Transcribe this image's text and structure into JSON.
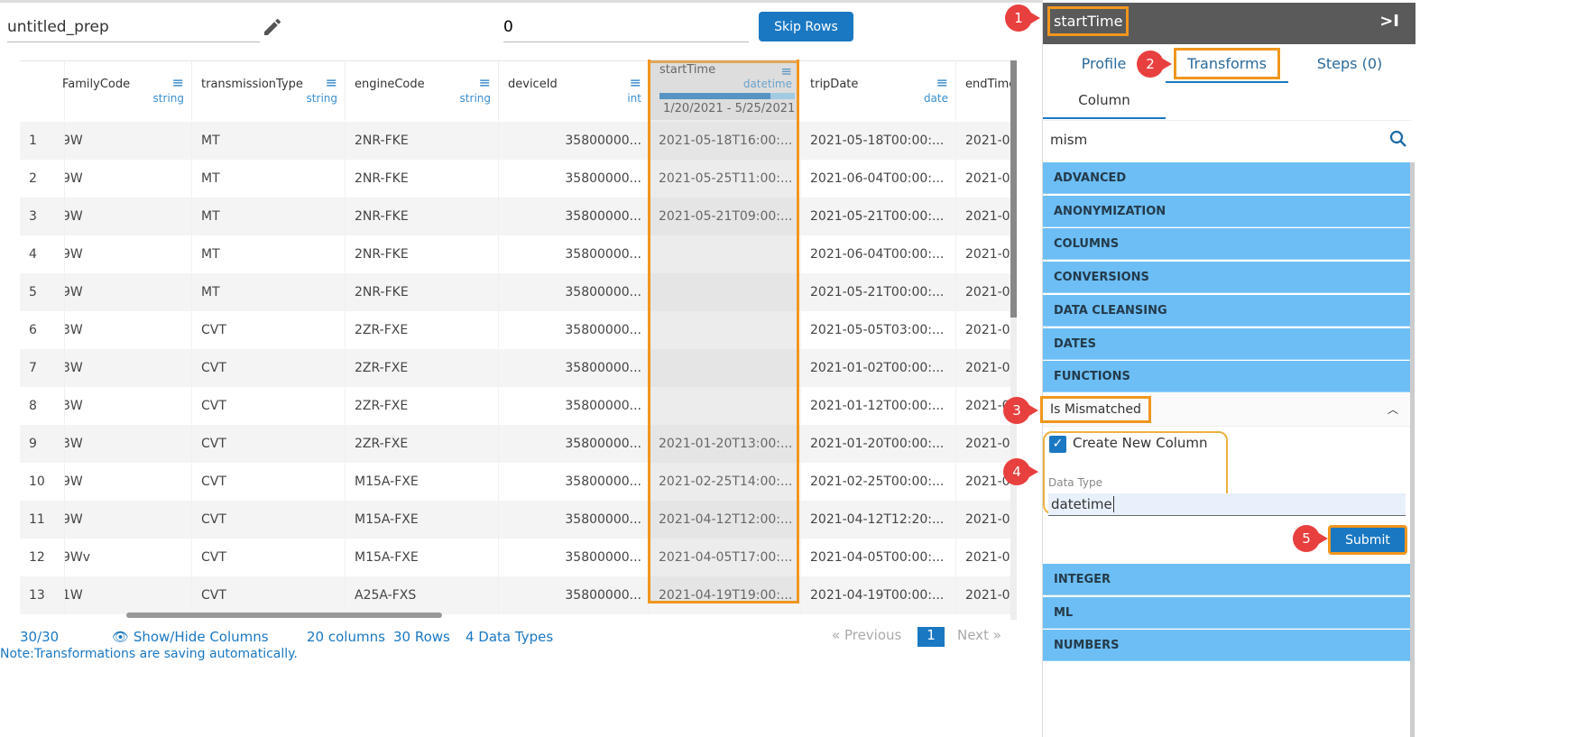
{
  "prep_name": "untitled_prep",
  "skip_value": "0",
  "skip_button": "Skip Rows",
  "columns": [
    {
      "name": "FamilyCode",
      "type": "string"
    },
    {
      "name": "transmissionType",
      "type": "string"
    },
    {
      "name": "engineCode",
      "type": "string"
    },
    {
      "name": "deviceId",
      "type": "int"
    },
    {
      "name": "startTime",
      "type": "datetime",
      "range": "1/20/2021 - 5/25/2021"
    },
    {
      "name": "tripDate",
      "type": "date"
    },
    {
      "name": "endTime",
      "type": ""
    }
  ],
  "rows": [
    [
      "1",
      "9W",
      "MT",
      "2NR-FKE",
      "35800000...",
      "2021-05-18T16:00:...",
      "2021-05-18T00:00:...",
      "2021-0"
    ],
    [
      "2",
      "9W",
      "MT",
      "2NR-FKE",
      "35800000...",
      "2021-05-25T11:00:...",
      "2021-06-04T00:00:...",
      "2021-0"
    ],
    [
      "3",
      "9W",
      "MT",
      "2NR-FKE",
      "35800000...",
      "2021-05-21T09:00:...",
      "2021-05-21T00:00:...",
      "2021-0"
    ],
    [
      "4",
      "9W",
      "MT",
      "2NR-FKE",
      "35800000...",
      "",
      "2021-06-04T00:00:...",
      "2021-0"
    ],
    [
      "5",
      "9W",
      "MT",
      "2NR-FKE",
      "35800000...",
      "",
      "2021-05-21T00:00:...",
      "2021-0"
    ],
    [
      "6",
      "3W",
      "CVT",
      "2ZR-FXE",
      "35800000...",
      "",
      "2021-05-05T03:00:...",
      "2021-0"
    ],
    [
      "7",
      "3W",
      "CVT",
      "2ZR-FXE",
      "35800000...",
      "",
      "2021-01-02T00:00:...",
      "2021-0"
    ],
    [
      "8",
      "3W",
      "CVT",
      "2ZR-FXE",
      "35800000...",
      "",
      "2021-01-12T00:00:...",
      "2021-0"
    ],
    [
      "9",
      "3W",
      "CVT",
      "2ZR-FXE",
      "35800000...",
      "2021-01-20T13:00:...",
      "2021-01-20T00:00:...",
      "2021-0"
    ],
    [
      "10",
      "9W",
      "CVT",
      "M15A-FXE",
      "35800000...",
      "2021-02-25T14:00:...",
      "2021-02-25T00:00:...",
      "2021-0"
    ],
    [
      "11",
      "9W",
      "CVT",
      "M15A-FXE",
      "35800000...",
      "2021-04-12T12:00:...",
      "2021-04-12T12:20:...",
      "2021-0"
    ],
    [
      "12",
      "9Wv",
      "CVT",
      "M15A-FXE",
      "35800000...",
      "2021-04-05T17:00:...",
      "2021-04-05T00:00:...",
      "2021-0"
    ],
    [
      "13",
      "1W",
      "CVT",
      "A25A-FXS",
      "35800000...",
      "2021-04-19T19:00:...",
      "2021-04-19T00:00:...",
      "2021-0"
    ]
  ],
  "footer": {
    "count": "30/30",
    "show_hide": "Show/Hide Columns",
    "columns": "20 columns",
    "rows": "30 Rows",
    "types": "4 Data Types",
    "note": "Note:Transformations are saving automatically."
  },
  "pager": {
    "prev": "« Previous",
    "page": "1",
    "next": "Next »"
  },
  "panel": {
    "title": "startTime",
    "collapse": ">I",
    "tabs": [
      "Profile",
      "Transforms",
      "Steps (0)"
    ],
    "subtab": "Column",
    "search": "mism",
    "categories_top": [
      "ADVANCED",
      "ANONYMIZATION",
      "COLUMNS",
      "CONVERSIONS",
      "DATA CLEANSING",
      "DATES",
      "FUNCTIONS"
    ],
    "expanded": "Is Mismatched",
    "checkbox_label": "Create New Column",
    "data_type_label": "Data Type",
    "data_type_value": "datetime",
    "submit": "Submit",
    "categories_bottom": [
      "INTEGER",
      "ML",
      "NUMBERS"
    ]
  },
  "badges": [
    "1",
    "2",
    "3",
    "4",
    "5"
  ],
  "colors": {
    "accent": "#1a78c2",
    "highlight": "#f0961e",
    "category": "#6cbef5",
    "badge": "#e8403f"
  }
}
